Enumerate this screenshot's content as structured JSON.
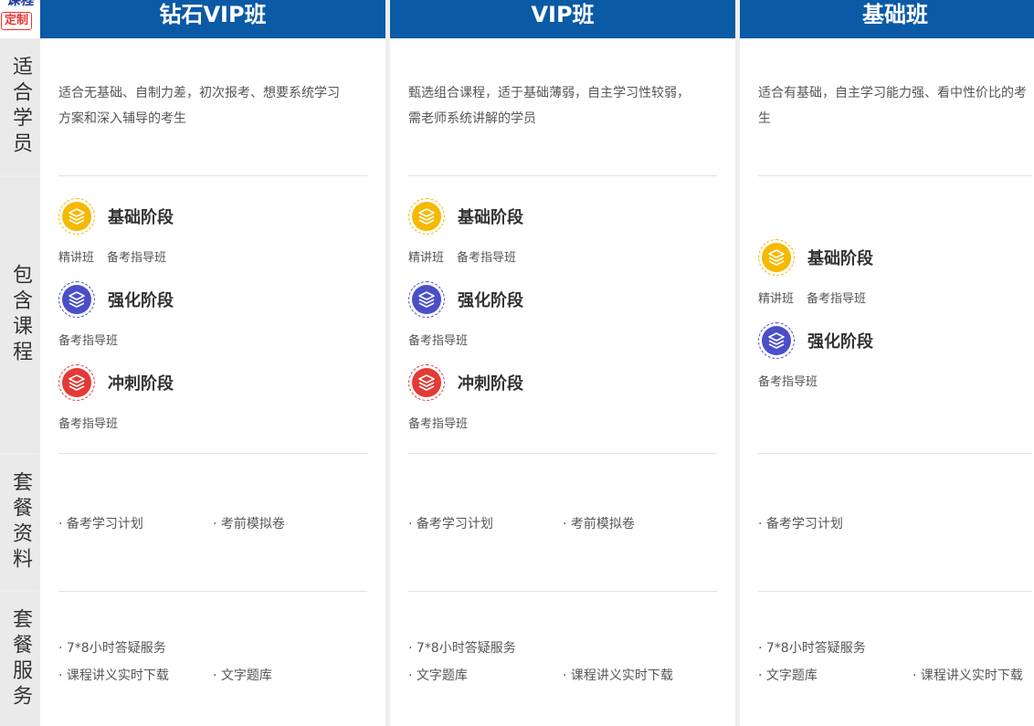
{
  "logo": {
    "line1": "课程",
    "line2": "定制"
  },
  "row_labels": [
    "适合学员",
    "包含课程",
    "套餐资料",
    "套餐服务"
  ],
  "colors": {
    "header": "#0a5aa5",
    "foundation": "#f6b800",
    "strengthen": "#4a4fc9",
    "sprint": "#e53935"
  },
  "columns": [
    {
      "title": "钻石VIP班",
      "suitable_lines": [
        "适合无基础、自制力差，初次报考、想要系统学习",
        "方案和深入辅导的考生"
      ],
      "stages": [
        {
          "icon": "layers-icon",
          "color": "#f6b800",
          "title": "基础阶段",
          "subs": [
            "精讲班",
            "备考指导班"
          ]
        },
        {
          "icon": "layers-icon",
          "color": "#4a4fc9",
          "title": "强化阶段",
          "subs": [
            "备考指导班"
          ]
        },
        {
          "icon": "layers-icon",
          "color": "#e53935",
          "title": "冲刺阶段",
          "subs": [
            "备考指导班"
          ]
        }
      ],
      "materials": [
        "· 备考学习计划",
        "· 考前模拟卷"
      ],
      "services": [
        "· 7*8小时答疑服务",
        "· 课程讲义实时下载",
        "· 文字题库"
      ]
    },
    {
      "title": "VIP班",
      "suitable_lines": [
        "甄选组合课程，适于基础薄弱，自主学习性较弱，",
        "需老师系统讲解的学员"
      ],
      "stages": [
        {
          "icon": "layers-icon",
          "color": "#f6b800",
          "title": "基础阶段",
          "subs": [
            "精讲班",
            "备考指导班"
          ]
        },
        {
          "icon": "layers-icon",
          "color": "#4a4fc9",
          "title": "强化阶段",
          "subs": [
            "备考指导班"
          ]
        },
        {
          "icon": "layers-icon",
          "color": "#e53935",
          "title": "冲刺阶段",
          "subs": [
            "备考指导班"
          ]
        }
      ],
      "materials": [
        "· 备考学习计划",
        "· 考前模拟卷"
      ],
      "services": [
        "· 7*8小时答疑服务",
        "· 文字题库",
        "· 课程讲义实时下载"
      ]
    },
    {
      "title": "基础班",
      "suitable_lines": [
        "适合有基础，自主学习能力强、看中性价比的考生"
      ],
      "stages": [
        {
          "icon": "layers-icon",
          "color": "#f6b800",
          "title": "基础阶段",
          "subs": [
            "精讲班",
            "备考指导班"
          ]
        },
        {
          "icon": "layers-icon",
          "color": "#4a4fc9",
          "title": "强化阶段",
          "subs": [
            "备考指导班"
          ]
        }
      ],
      "materials": [
        "· 备考学习计划"
      ],
      "services": [
        "· 7*8小时答疑服务",
        "· 文字题库",
        "· 课程讲义实时下载"
      ]
    }
  ]
}
